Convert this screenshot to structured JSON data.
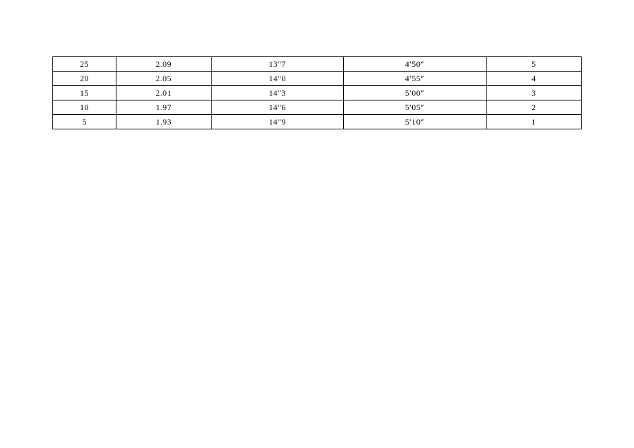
{
  "chart_data": {
    "type": "table",
    "rows": [
      {
        "c1": "25",
        "c2": "2.09",
        "c3": "13″7",
        "c4": "4′50″",
        "c5": "5"
      },
      {
        "c1": "20",
        "c2": "2.05",
        "c3": "14″0",
        "c4": "4′55″",
        "c5": "4"
      },
      {
        "c1": "15",
        "c2": "2.01",
        "c3": "14″3",
        "c4": "5′00″",
        "c5": "3"
      },
      {
        "c1": "10",
        "c2": "1.97",
        "c3": "14″6",
        "c4": "5′05″",
        "c5": "2"
      },
      {
        "c1": "5",
        "c2": "1.93",
        "c3": "14″9",
        "c4": "5′10″",
        "c5": "1"
      }
    ]
  }
}
